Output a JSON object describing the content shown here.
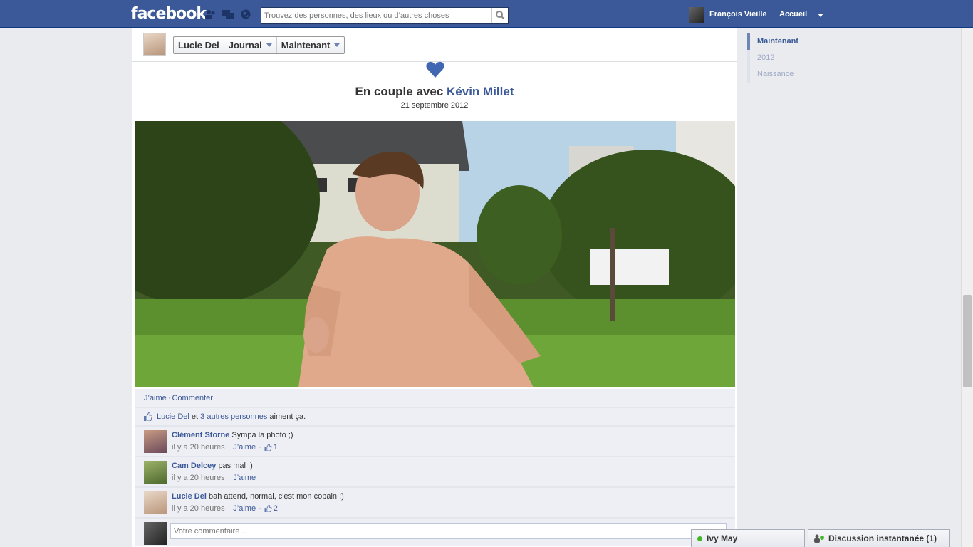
{
  "nav": {
    "logo": "facebook",
    "search_placeholder": "Trouvez des personnes, des lieux ou d’autres choses",
    "user_name": "François Vieille",
    "home": "Accueil"
  },
  "profile": {
    "name": "Lucie Del",
    "section": "Journal",
    "period": "Maintenant"
  },
  "event": {
    "prefix": "En couple avec",
    "partner": "Kévin Millet",
    "date": "21 septembre 2012"
  },
  "ufi": {
    "like": "J’aime",
    "comment": "Commenter",
    "likes_person": "Lucie Del",
    "likes_and": "et",
    "likes_others": "3 autres personnes",
    "likes_suffix": "aiment ça.",
    "comments": [
      {
        "author": "Clément Storne",
        "text": "Sympa la photo ;)",
        "time": "il y a 20 heures",
        "like": "J’aime",
        "likes": "1"
      },
      {
        "author": "Cam Delcey",
        "text": "pas mal ;)",
        "time": "il y a 20 heures",
        "like": "J’aime",
        "likes": ""
      },
      {
        "author": "Lucie Del",
        "text": "bah attend, normal, c'est mon copain :)",
        "time": "il y a 20 heures",
        "like": "J’aime",
        "likes": "2"
      }
    ],
    "composer_placeholder": "Votre commentaire…"
  },
  "scrubber": [
    "Maintenant",
    "2012",
    "Naissance"
  ],
  "chat": {
    "contact": "Ivy May",
    "sidebar": "Discussion instantanée (1)"
  },
  "colors": {
    "brand": "#3b5998",
    "online": "#42b72a"
  }
}
